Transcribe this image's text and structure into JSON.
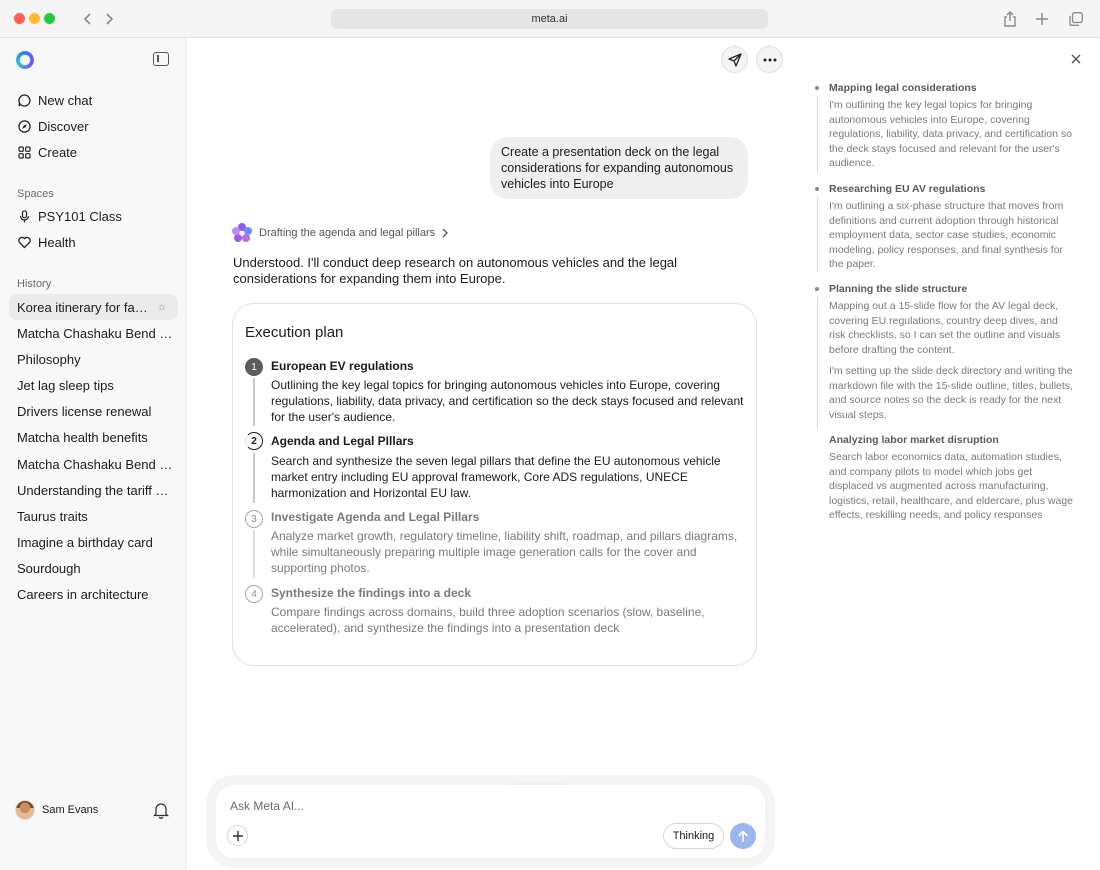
{
  "browser": {
    "url": "meta.ai"
  },
  "sidebar": {
    "nav": [
      {
        "label": "New chat",
        "icon": "chat-bubble-icon"
      },
      {
        "label": "Discover",
        "icon": "compass-icon"
      },
      {
        "label": "Create",
        "icon": "grid-icon"
      }
    ],
    "spaces_label": "Spaces",
    "spaces": [
      {
        "label": "PSY101 Class",
        "icon": "microphone-icon"
      },
      {
        "label": "Health",
        "icon": "heart-icon"
      }
    ],
    "history_label": "History",
    "history": [
      "Korea itinerary for family",
      "Matcha Chashaku Bend Purpose",
      "Philosophy",
      "Jet lag sleep tips",
      "Drivers license renewal",
      "Matcha health benefits",
      "Matcha Chashaku Bend Purpose",
      "Understanding the tariff situation",
      "Taurus traits",
      "Imagine a birthday card",
      "Sourdough",
      "Careers in architecture"
    ],
    "user": {
      "name": "Sam Evans"
    }
  },
  "chat": {
    "user_message": "Create a presentation deck on the legal considerations for expanding autonomous vehicles into Europe",
    "status": "Drafting the agenda and legal pillars",
    "answer": "Understood. I'll conduct deep research on autonomous vehicles and the legal considerations for expanding them into Europe.",
    "plan": {
      "title": "Execution plan",
      "steps": [
        {
          "num": "1",
          "state": "done",
          "title": "European EV regulations",
          "desc": "Outlining the key legal topics for bringing autonomous vehicles into Europe, covering regulations, liability, data privacy, and certification so the deck stays focused and relevant for the user's audience."
        },
        {
          "num": "2",
          "state": "active",
          "title": "Agenda and Legal PIllars",
          "desc": "Search and synthesize the seven legal pillars that define the EU autonomous vehicle market entry including EU approval framework, Core ADS regulations, UNECE harmonization and Horizontal EU law."
        },
        {
          "num": "3",
          "state": "pending",
          "title": "Investigate Agenda and Legal Pillars",
          "desc": "Analyze market growth, regulatory timeline, liability shift, roadmap, and pillars diagrams, while simultaneously preparing multiple image generation calls for the cover and supporting photos."
        },
        {
          "num": "4",
          "state": "pending",
          "title": "Synthesize the findings into a deck",
          "desc": "Compare findings across domains, build three adoption scenarios (slow, baseline, accelerated), and synthesize the findings into a presentation deck"
        }
      ]
    }
  },
  "composer": {
    "placeholder": "Ask Meta AI...",
    "thinking_label": "Thinking",
    "send_color": "#9bb5ef"
  },
  "activity": [
    {
      "title": "Mapping legal considerations",
      "desc": [
        "I'm outlining the key legal topics for bringing autonomous vehicles into Europe, covering regulations, liability, data privacy, and certification so the deck stays focused and relevant for the user's audience."
      ]
    },
    {
      "title": "Researching EU AV regulations",
      "desc": [
        "I'm outlining a six-phase structure that moves from definitions and current adoption through historical employment data, sector case studies, economic modeling, policy responses, and final synthesis for the paper."
      ]
    },
    {
      "title": "Planning the slide structure",
      "desc": [
        "Mapping out a 15-slide flow for the AV legal deck, covering EU regulations, country deep dives, and risk checklists, so I can set the outline and visuals before drafting the content.",
        "I'm setting up the slide deck directory and writing the markdown file with the 15-slide outline, titles, bullets, and source notes so the deck is ready for the next visual steps."
      ]
    },
    {
      "title": "Analyzing labor market disruption",
      "desc": [
        "Search labor economics data, automation studies, and company pilots to model which jobs get displaced vs augmented across manufacturing, logistics, retail, healthcare, and eldercare, plus wage effects, reskilling needs, and policy responses"
      ]
    }
  ]
}
